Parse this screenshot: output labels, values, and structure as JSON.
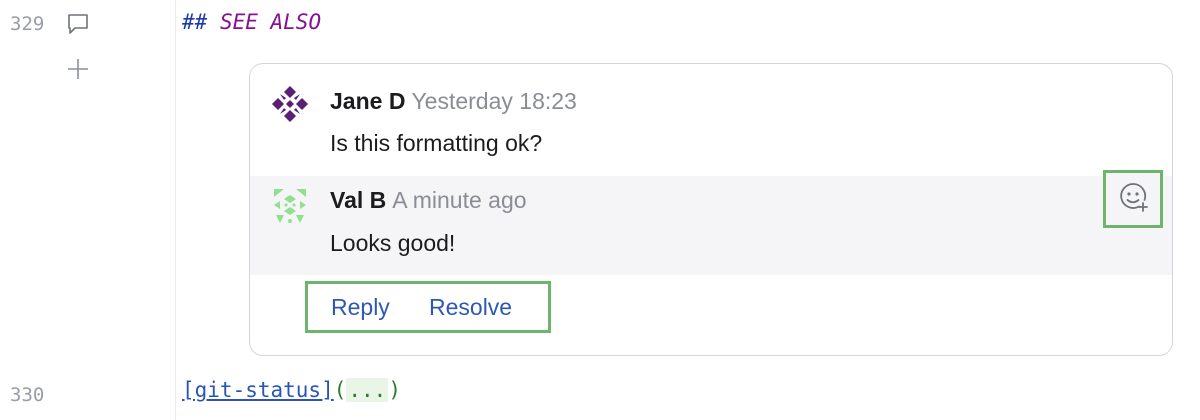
{
  "gutter": {
    "line_top": "329",
    "line_bottom": "330",
    "icons": [
      "comment-icon",
      "plus-icon"
    ]
  },
  "editor": {
    "heading_hashes": "##",
    "heading_text": "SEE ALSO",
    "link_text": "[git-status]",
    "link_open": "(",
    "link_dots": "...",
    "link_close": ")"
  },
  "thread": {
    "comments": [
      {
        "author": "Jane D",
        "time": "Yesterday 18:23",
        "text": "Is this formatting ok?",
        "avatar": "geometric-avatar-purple"
      },
      {
        "author": "Val B",
        "time": "A minute ago",
        "text": "Looks good!",
        "avatar": "geometric-avatar-green"
      }
    ],
    "reaction_icon": "add-reaction-icon",
    "actions": {
      "reply": "Reply",
      "resolve": "Resolve"
    }
  },
  "colors": {
    "highlight_border": "#6db56d",
    "link": "#2f58b5",
    "keyword": "#871094"
  }
}
